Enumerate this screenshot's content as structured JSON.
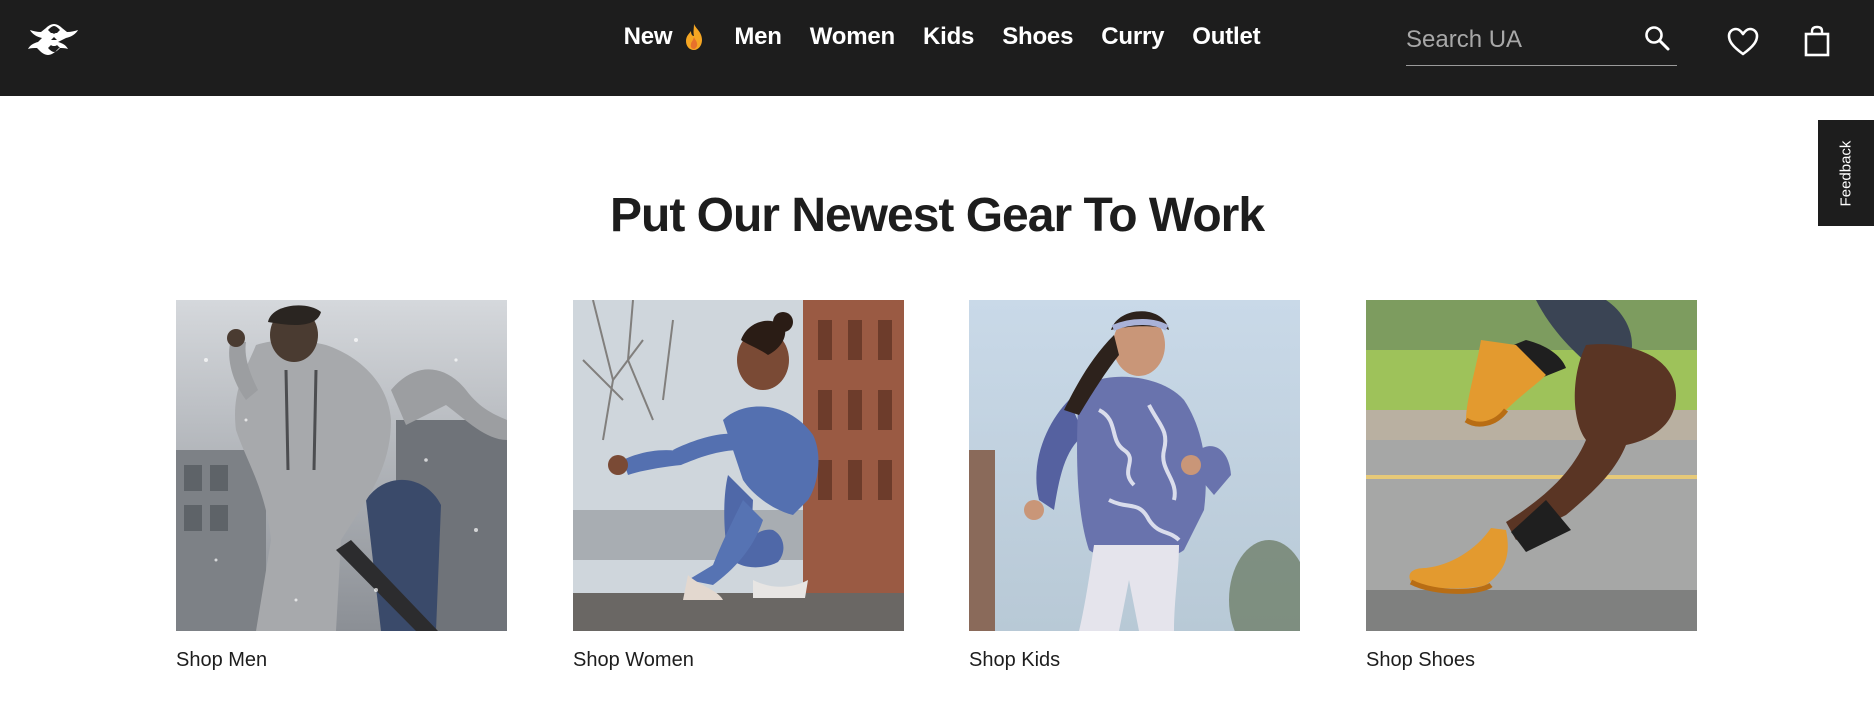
{
  "header": {
    "logo_name": "ua-logo-icon",
    "nav": [
      {
        "label": "New",
        "icon": "flame-icon"
      },
      {
        "label": "Men"
      },
      {
        "label": "Women"
      },
      {
        "label": "Kids"
      },
      {
        "label": "Shoes"
      },
      {
        "label": "Curry"
      },
      {
        "label": "Outlet"
      }
    ],
    "search": {
      "placeholder": "Search UA",
      "value": ""
    },
    "icons": [
      "search-icon",
      "heart-icon",
      "bag-icon"
    ]
  },
  "feedback": {
    "label": "Feedback"
  },
  "main": {
    "headline": "Put Our Newest Gear To Work",
    "cards": [
      {
        "label": "Shop Men"
      },
      {
        "label": "Shop Women"
      },
      {
        "label": "Shop Kids"
      },
      {
        "label": "Shop Shoes"
      }
    ]
  },
  "colors": {
    "header_bg": "#1d1d1d",
    "accent_flame": "#f5a623",
    "text": "#1d1d1d",
    "white": "#ffffff"
  }
}
